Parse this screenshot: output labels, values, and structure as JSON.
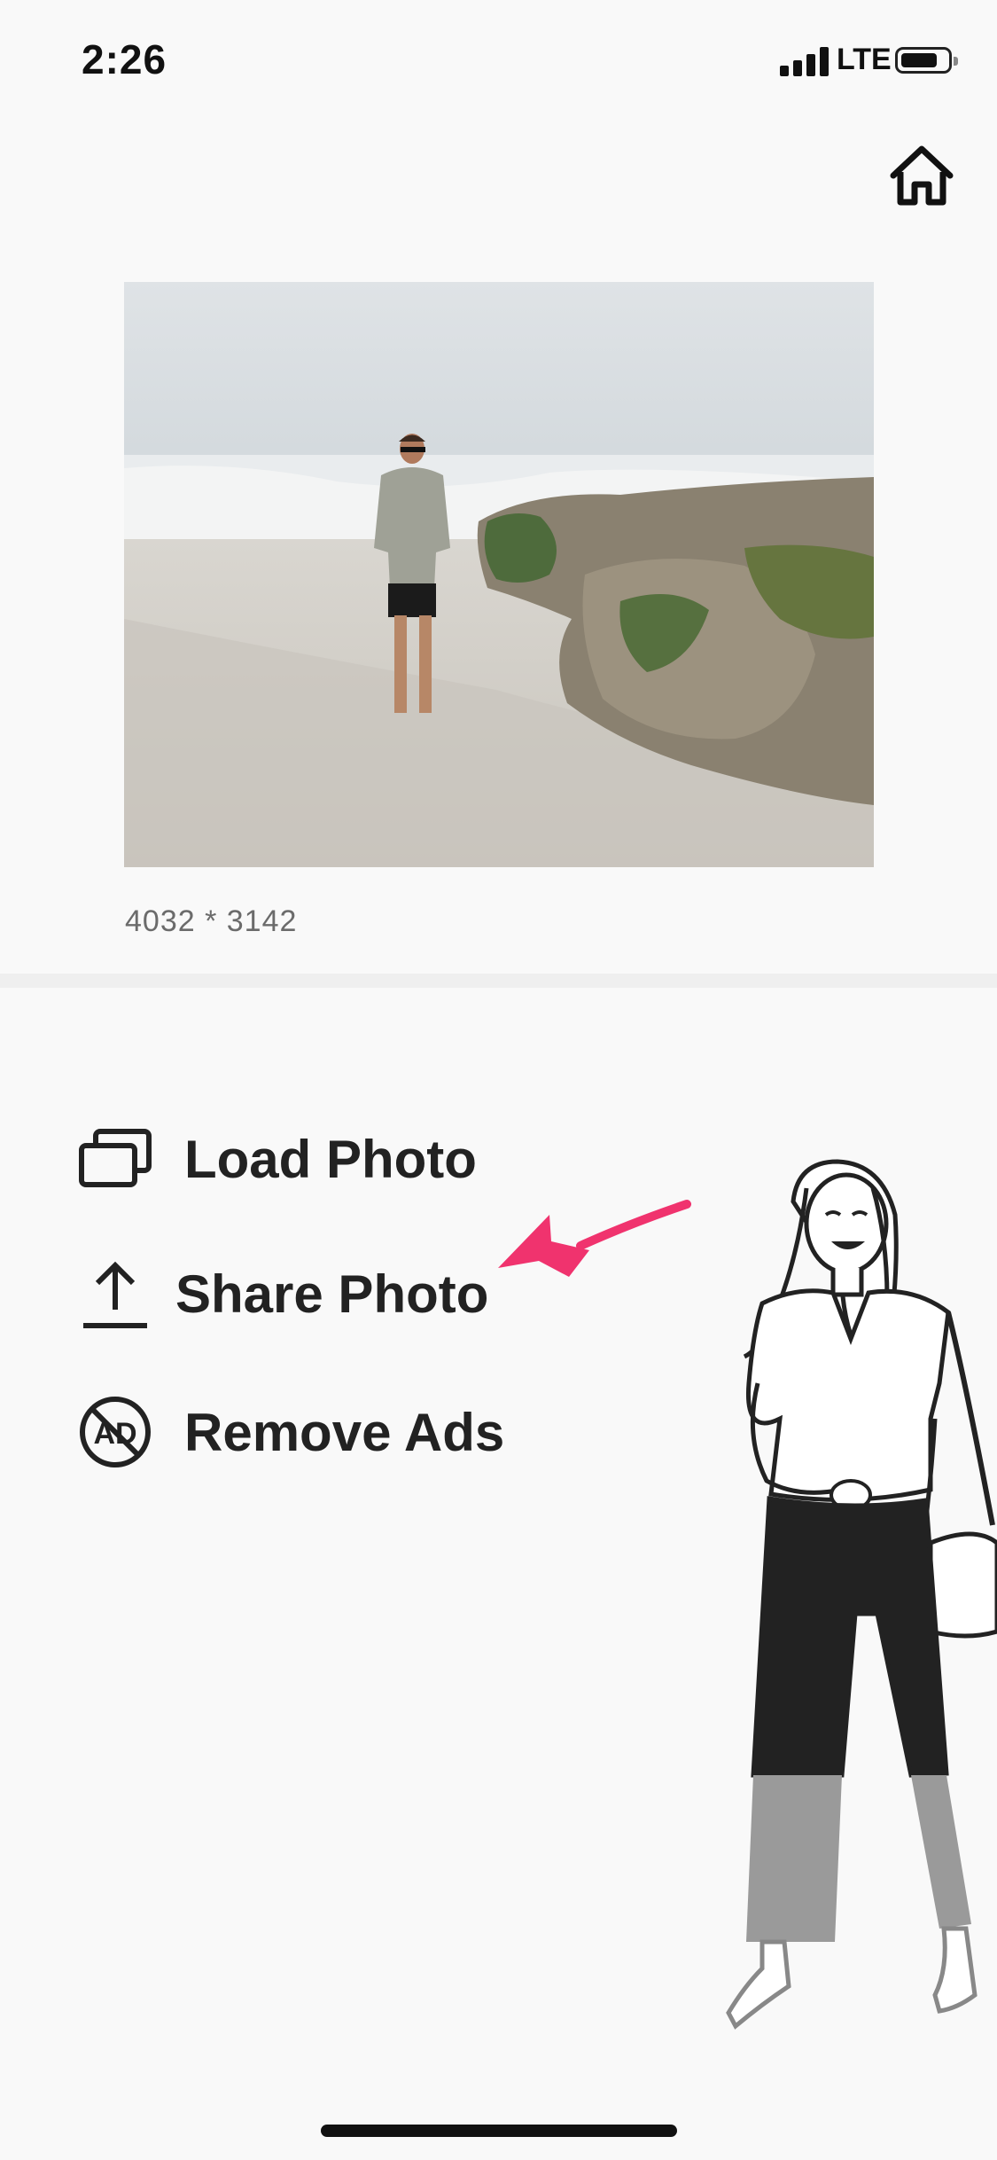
{
  "status_bar": {
    "time": "2:26",
    "carrier": "LTE"
  },
  "header": {
    "home_icon": "home-icon"
  },
  "photo": {
    "dimensions": "4032 * 3142"
  },
  "menu": {
    "items": [
      {
        "label": "Load Photo",
        "icon": "photos-stack-icon"
      },
      {
        "label": "Share Photo",
        "icon": "upload-icon"
      },
      {
        "label": "Remove Ads",
        "icon": "no-ads-icon"
      }
    ]
  },
  "colors": {
    "background": "#f9f9f9",
    "text": "#222222",
    "annotation_arrow": "#f0336e"
  }
}
